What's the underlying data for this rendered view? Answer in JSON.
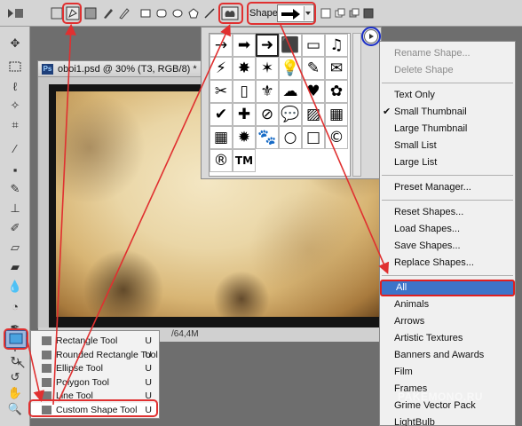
{
  "options_bar": {
    "shape_label": "Shape:",
    "icons": [
      "tool-preset-icon",
      "shape-layers-icon",
      "paths-icon",
      "fill-pixels-icon",
      "pen-icon",
      "freeform-pen-icon",
      "rectangle-shape-icon",
      "rounded-rectangle-shape-icon",
      "ellipse-shape-icon",
      "polygon-shape-icon",
      "line-shape-icon",
      "custom-shape-icon",
      "combine-mode-icon"
    ]
  },
  "document": {
    "title": "oboi1.psd @ 30% (T3, RGB/8) *",
    "size_status": "/64,4M"
  },
  "shape_panel": {
    "shapes": [
      [
        "→",
        "➡",
        "➜",
        "⬛",
        "▭",
        "♫"
      ],
      [
        "⚡",
        "✸",
        "✶",
        "💡",
        "✎",
        "✉"
      ],
      [
        "✂",
        "▯",
        "⚜",
        "☁",
        "♥",
        "✿"
      ],
      [
        "✔",
        "✚",
        "⊘",
        "💬",
        "▨",
        "▦"
      ],
      [
        "▦",
        "✹",
        "🐾",
        "○",
        "□",
        "©"
      ],
      [
        "®",
        "TM"
      ]
    ]
  },
  "menu": {
    "items": [
      {
        "label": "Rename Shape...",
        "enabled": false
      },
      {
        "label": "Delete Shape",
        "enabled": false
      },
      {
        "sep": true
      },
      {
        "label": "Text Only",
        "enabled": true
      },
      {
        "label": "Small Thumbnail",
        "enabled": true,
        "checked": true
      },
      {
        "label": "Large Thumbnail",
        "enabled": true
      },
      {
        "label": "Small List",
        "enabled": true
      },
      {
        "label": "Large List",
        "enabled": true
      },
      {
        "sep": true
      },
      {
        "label": "Preset Manager...",
        "enabled": true
      },
      {
        "sep": true
      },
      {
        "label": "Reset Shapes...",
        "enabled": true
      },
      {
        "label": "Load Shapes...",
        "enabled": true
      },
      {
        "label": "Save Shapes...",
        "enabled": true
      },
      {
        "label": "Replace Shapes...",
        "enabled": true
      },
      {
        "sep": true
      },
      {
        "label": "All",
        "enabled": true,
        "highlight": true
      },
      {
        "label": "Animals",
        "enabled": true
      },
      {
        "label": "Arrows",
        "enabled": true
      },
      {
        "label": "Artistic Textures",
        "enabled": true
      },
      {
        "label": "Banners and Awards",
        "enabled": true
      },
      {
        "label": "Film",
        "enabled": true
      },
      {
        "label": "Frames",
        "enabled": true
      },
      {
        "label": "Grime Vector Pack",
        "enabled": true
      },
      {
        "label": "LightBulb",
        "enabled": true
      }
    ],
    "check_mark": "✔"
  },
  "flyout": {
    "items": [
      {
        "label": "Rectangle Tool",
        "key": "U"
      },
      {
        "label": "Rounded Rectangle Tool",
        "key": "U"
      },
      {
        "label": "Ellipse Tool",
        "key": "U"
      },
      {
        "label": "Polygon Tool",
        "key": "U"
      },
      {
        "label": "Line Tool",
        "key": "U"
      },
      {
        "label": "Custom Shape Tool",
        "key": "U",
        "active": true
      }
    ]
  },
  "watermark": "PAKEMONO.RU",
  "colors": {
    "highlight": "#3d74c9",
    "annotation_red": "#e03030",
    "annotation_blue": "#1a2ec8"
  }
}
